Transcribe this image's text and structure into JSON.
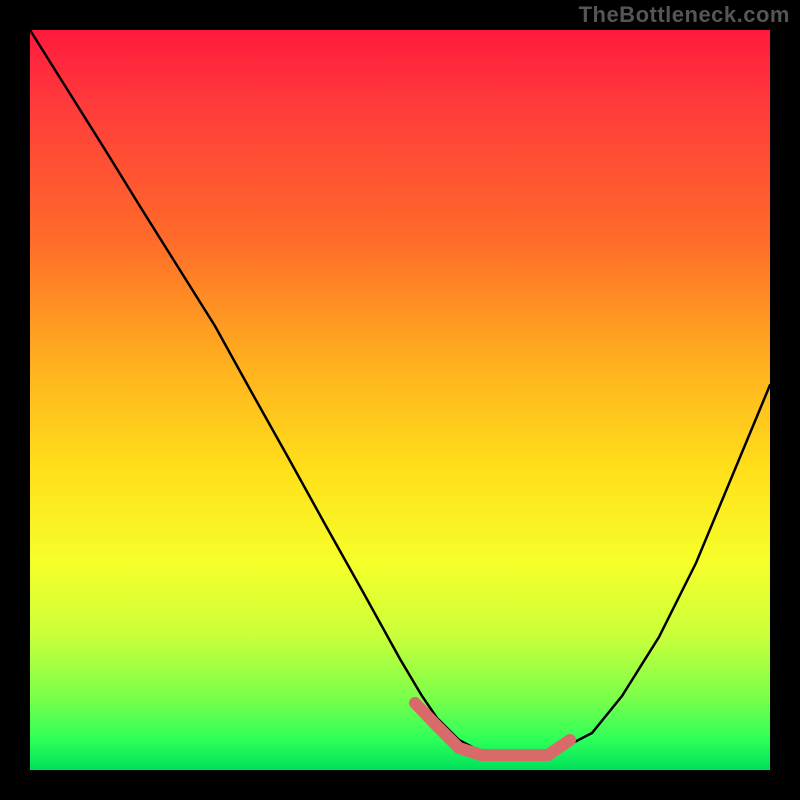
{
  "watermark": "TheBottleneck.com",
  "chart_data": {
    "type": "line",
    "title": "",
    "xlabel": "",
    "ylabel": "",
    "xlim": [
      0,
      100
    ],
    "ylim": [
      0,
      100
    ],
    "grid": false,
    "legend": null,
    "series": [
      {
        "name": "curve",
        "color": "#000000",
        "x": [
          0,
          5,
          10,
          15,
          20,
          25,
          30,
          35,
          40,
          45,
          50,
          53,
          55,
          58,
          60,
          63,
          65,
          68,
          72,
          76,
          80,
          85,
          90,
          95,
          100
        ],
        "values": [
          100,
          92,
          84,
          76,
          68,
          60,
          51,
          42,
          33,
          24,
          15,
          10,
          7,
          4,
          3,
          2,
          2,
          2,
          3,
          5,
          10,
          18,
          28,
          40,
          52
        ]
      },
      {
        "name": "optimal-segment",
        "color": "#d86a6a",
        "x": [
          52,
          55,
          58,
          61,
          64,
          67,
          70,
          73
        ],
        "values": [
          9,
          6,
          3,
          2,
          2,
          2,
          2,
          4
        ]
      }
    ],
    "annotations": []
  },
  "colors": {
    "gradient_top": "#ff1a3c",
    "gradient_mid": "#ffe11a",
    "gradient_bottom": "#00e05a",
    "curve": "#000000",
    "highlight": "#d86a6a",
    "frame": "#000000",
    "watermark": "#555555"
  }
}
